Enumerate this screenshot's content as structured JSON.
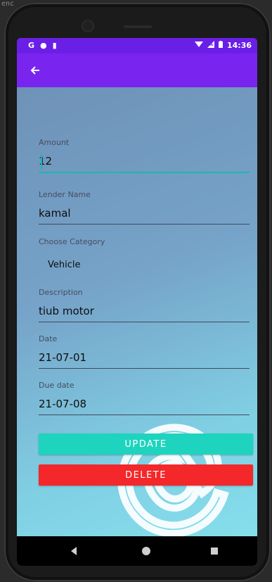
{
  "ide": {
    "snippet": "enc"
  },
  "statusbar": {
    "left_icons": [
      "G",
      "●",
      "▮"
    ],
    "time": "14:36"
  },
  "appbar": {
    "back_icon": "arrow-left"
  },
  "form": {
    "amount": {
      "label": "Amount",
      "value": "12"
    },
    "lender_name": {
      "label": "Lender Name",
      "value": "kamal"
    },
    "category": {
      "label": "Choose Category",
      "value": "Vehicle"
    },
    "description": {
      "label": "Description",
      "value": "tiub motor"
    },
    "date": {
      "label": "Date",
      "value": "21-07-01"
    },
    "due_date": {
      "label": "Due date",
      "value": "21-07-08"
    }
  },
  "buttons": {
    "update": "UPDATE",
    "delete": "DELETE"
  },
  "watermark": {
    "text": "@"
  },
  "colors": {
    "statusbar": "#6a1fe6",
    "appbar": "#7a24f0",
    "update": "#1ed4be",
    "delete": "#f4272a",
    "accent": "#1bb7b0"
  }
}
